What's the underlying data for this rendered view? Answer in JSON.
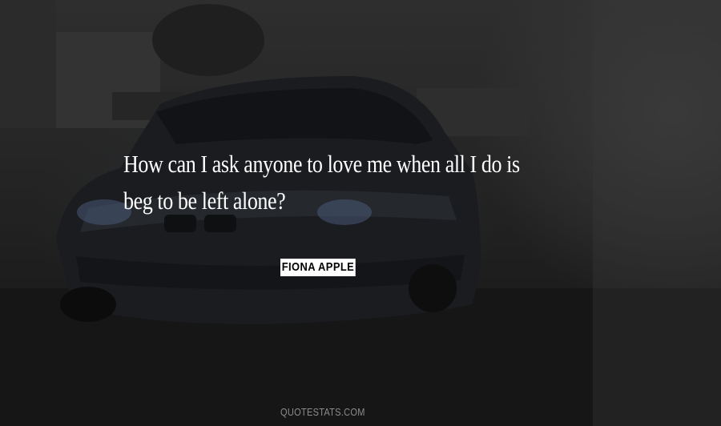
{
  "quote": {
    "lines": [
      "How can I ask anyone to love me when all I do is",
      "beg to be left alone?"
    ]
  },
  "author": "FIONA APPLE",
  "watermark": "QUOTESTATS.COM",
  "colors": {
    "quote_text": "#ffffff",
    "author_bg": "#ffffff",
    "author_text": "#000000",
    "watermark": "#8c8c8c",
    "background": "#1e1e1e"
  }
}
